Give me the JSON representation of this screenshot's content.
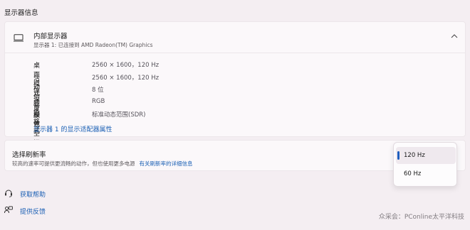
{
  "section": {
    "title": "显示器信息"
  },
  "display": {
    "title": "内部显示器",
    "subtitle": "显示器 1: 已连接到 AMD Radeon(TM) Graphics",
    "rows": [
      {
        "label": "桌面模式",
        "value": "2560 × 1600，120 Hz"
      },
      {
        "label": "活动信号模式",
        "value": "2560 × 1600，120 Hz"
      },
      {
        "label": "位深度",
        "value": "8 位"
      },
      {
        "label": "颜色格式",
        "value": "RGB"
      },
      {
        "label": "颜色空间",
        "value": "标准动态范围(SDR)"
      }
    ],
    "adapter_link": "显示器 1 的显示适配器属性"
  },
  "refresh": {
    "title": "选择刷新率",
    "description": "较高的速率可提供更流畅的动作，但也使用更多电源",
    "details_link": "有关刷新率的详细信息",
    "options": [
      "120 Hz",
      "60 Hz"
    ],
    "selected": "120 Hz"
  },
  "footer": {
    "help": "获取帮助",
    "feedback": "提供反馈"
  },
  "watermark": "众采会：PConline太平洋科技",
  "colors": {
    "accent": "#1f5fbf",
    "link": "#1a5fb4",
    "background": "#f4eef2",
    "card": "#fbf8fa"
  }
}
